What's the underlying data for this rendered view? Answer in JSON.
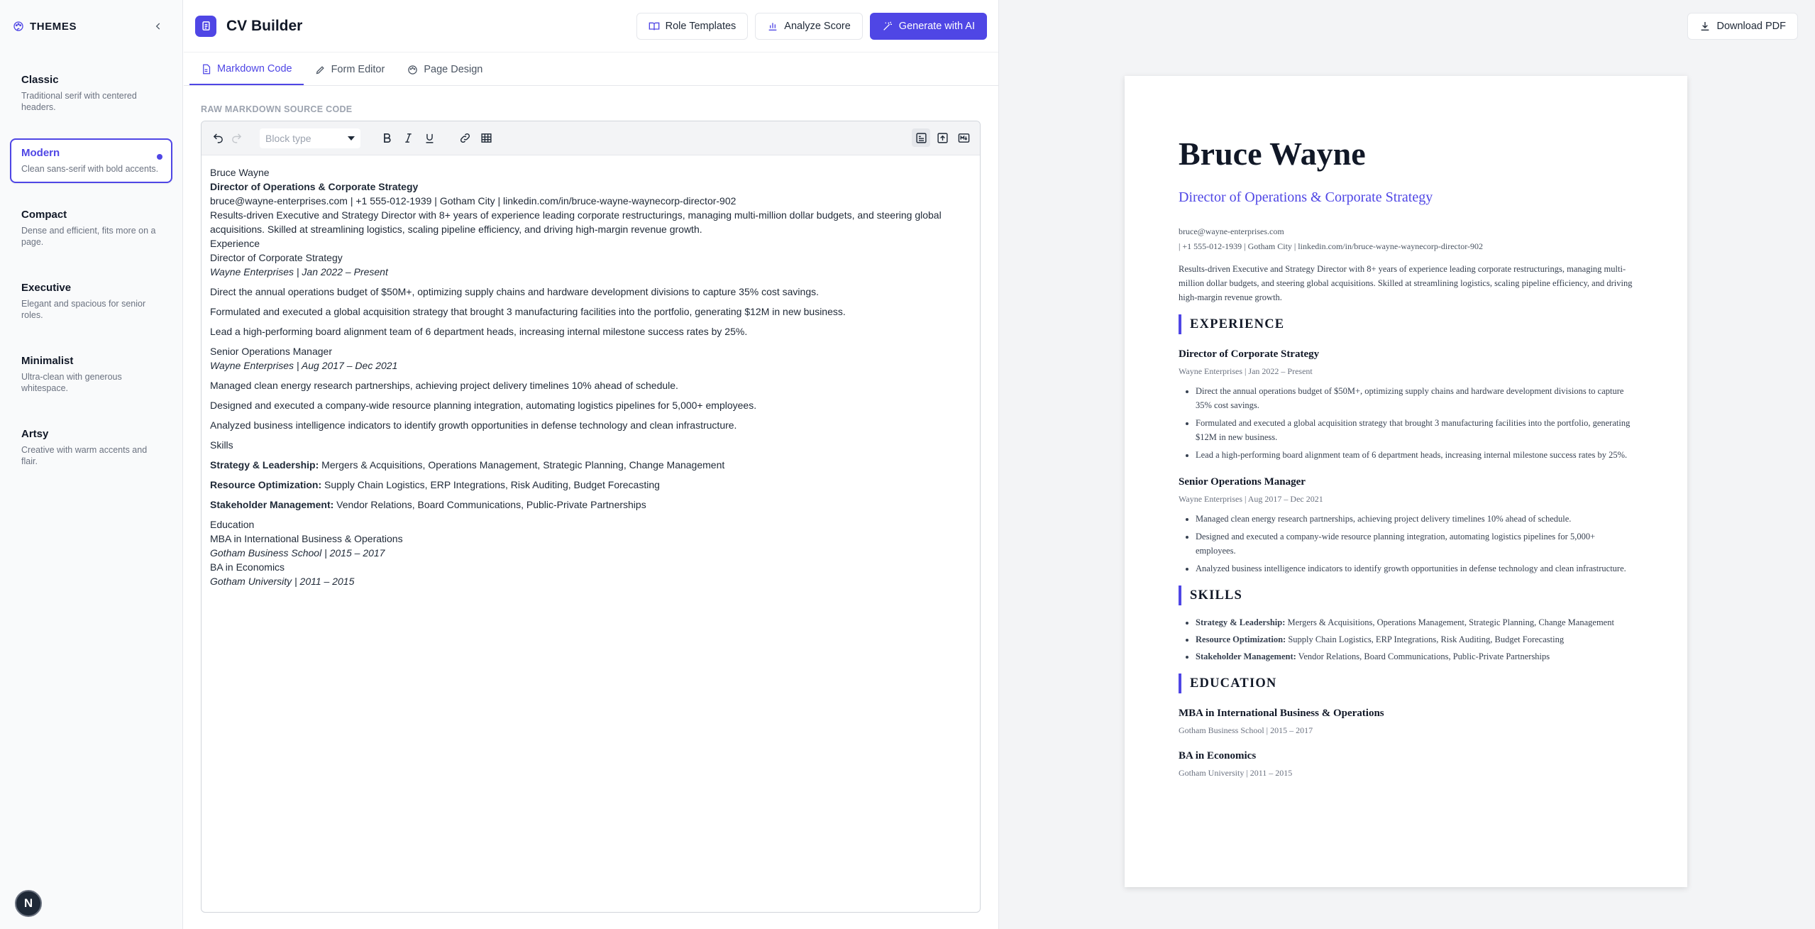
{
  "sidebar": {
    "title": "THEMES",
    "themes": [
      {
        "name": "Classic",
        "desc": "Traditional serif with centered headers."
      },
      {
        "name": "Modern",
        "desc": "Clean sans-serif with bold accents."
      },
      {
        "name": "Compact",
        "desc": "Dense and efficient, fits more on a page."
      },
      {
        "name": "Executive",
        "desc": "Elegant and spacious for senior roles."
      },
      {
        "name": "Minimalist",
        "desc": "Ultra-clean with generous whitespace."
      },
      {
        "name": "Artsy",
        "desc": "Creative with warm accents and flair."
      }
    ],
    "active_theme": "Modern",
    "avatar_letter": "N"
  },
  "header": {
    "app_title": "CV Builder",
    "role_templates": "Role Templates",
    "analyze_score": "Analyze Score",
    "generate_ai": "Generate with AI"
  },
  "tabs": [
    {
      "label": "Markdown Code",
      "active": true
    },
    {
      "label": "Form Editor",
      "active": false
    },
    {
      "label": "Page Design",
      "active": false
    }
  ],
  "editor": {
    "section_label": "RAW MARKDOWN SOURCE CODE",
    "block_type_placeholder": "Block type",
    "lines": {
      "name": "Bruce Wayne",
      "role": "Director of Operations & Corporate Strategy",
      "contact": "bruce@wayne-enterprises.com | +1 555-012-1939 | Gotham City | linkedin.com/in/bruce-wayne-waynecorp-director-902",
      "summary": "Results-driven Executive and Strategy Director with 8+ years of experience leading corporate restructurings, managing multi-million dollar budgets, and steering global acquisitions. Skilled at streamlining logistics, scaling pipeline efficiency, and driving high-margin revenue growth.",
      "experience": "Experience",
      "job1_title": "Director of Corporate Strategy",
      "job1_meta": "Wayne Enterprises | Jan 2022 – Present",
      "job1_b1": "Direct the annual operations budget of $50M+, optimizing supply chains and hardware development divisions to capture 35% cost savings.",
      "job1_b2": "Formulated and executed a global acquisition strategy that brought 3 manufacturing facilities into the portfolio, generating $12M in new business.",
      "job1_b3": "Lead a high-performing board alignment team of 6 department heads, increasing internal milestone success rates by 25%.",
      "job2_title": "Senior Operations Manager",
      "job2_meta": "Wayne Enterprises | Aug 2017 – Dec 2021",
      "job2_b1": "Managed clean energy research partnerships, achieving project delivery timelines 10% ahead of schedule.",
      "job2_b2": "Designed and executed a company-wide resource planning integration, automating logistics pipelines for 5,000+ employees.",
      "job2_b3": "Analyzed business intelligence indicators to identify growth opportunities in defense technology and clean infrastructure.",
      "skills": "Skills",
      "skill1_label": "Strategy & Leadership:",
      "skill1_value": " Mergers & Acquisitions, Operations Management, Strategic Planning, Change Management",
      "skill2_label": "Resource Optimization:",
      "skill2_value": " Supply Chain Logistics, ERP Integrations, Risk Auditing, Budget Forecasting",
      "skill3_label": "Stakeholder Management:",
      "skill3_value": " Vendor Relations, Board Communications, Public-Private Partnerships",
      "education": "Education",
      "edu1_title": "MBA in International Business & Operations",
      "edu1_meta": "Gotham Business School | 2015 – 2017",
      "edu2_title": "BA in Economics",
      "edu2_meta": "Gotham University | 2011 – 2015"
    }
  },
  "preview": {
    "download_pdf": "Download PDF",
    "name": "Bruce Wayne",
    "role": "Director of Operations & Corporate Strategy",
    "email": "bruce@wayne-enterprises.com",
    "contact_line": "| +1 555-012-1939 | Gotham City | linkedin.com/in/bruce-wayne-waynecorp-director-902",
    "summary": "Results-driven Executive and Strategy Director with 8+ years of experience leading corporate restructurings, managing multi-million dollar budgets, and steering global acquisitions. Skilled at streamlining logistics, scaling pipeline efficiency, and driving high-margin revenue growth.",
    "h_experience": "EXPERIENCE",
    "h_skills": "SKILLS",
    "h_education": "EDUCATION",
    "job1_title": "Director of Corporate Strategy",
    "job1_meta": "Wayne Enterprises | Jan 2022 – Present",
    "job1_b1": "Direct the annual operations budget of $50M+, optimizing supply chains and hardware development divisions to capture 35% cost savings.",
    "job1_b2": "Formulated and executed a global acquisition strategy that brought 3 manufacturing facilities into the portfolio, generating $12M in new business.",
    "job1_b3": "Lead a high-performing board alignment team of 6 department heads, increasing internal milestone success rates by 25%.",
    "job2_title": "Senior Operations Manager",
    "job2_meta": "Wayne Enterprises | Aug 2017 – Dec 2021",
    "job2_b1": "Managed clean energy research partnerships, achieving project delivery timelines 10% ahead of schedule.",
    "job2_b2": "Designed and executed a company-wide resource planning integration, automating logistics pipelines for 5,000+ employees.",
    "job2_b3": "Analyzed business intelligence indicators to identify growth opportunities in defense technology and clean infrastructure.",
    "skill1_label": "Strategy & Leadership:",
    "skill1_value": " Mergers & Acquisitions, Operations Management, Strategic Planning, Change Management",
    "skill2_label": "Resource Optimization:",
    "skill2_value": " Supply Chain Logistics, ERP Integrations, Risk Auditing, Budget Forecasting",
    "skill3_label": "Stakeholder Management:",
    "skill3_value": " Vendor Relations, Board Communications, Public-Private Partnerships",
    "edu1_title": "MBA in International Business & Operations",
    "edu1_meta": "Gotham Business School | 2015 – 2017",
    "edu2_title": "BA in Economics",
    "edu2_meta": "Gotham University | 2011 – 2015"
  },
  "colors": {
    "accent": "#4f46e5",
    "sidebar_bg": "#f9fafb",
    "preview_bg": "#f3f4f6"
  },
  "icons": [
    "palette-icon",
    "chevron-left-icon",
    "document-icon",
    "book-open-icon",
    "bar-chart-icon",
    "magic-wand-icon",
    "download-icon",
    "file-code-icon",
    "pencil-icon",
    "palette-icon",
    "undo-icon",
    "redo-icon",
    "bold-icon",
    "italic-icon",
    "underline-icon",
    "link-icon",
    "table-icon",
    "rich-text-icon",
    "source-icon",
    "markdown-icon"
  ]
}
